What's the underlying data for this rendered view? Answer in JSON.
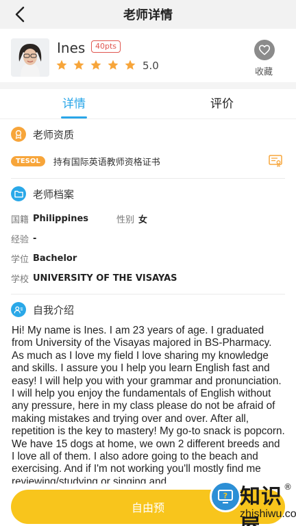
{
  "nav": {
    "title": "老师详情"
  },
  "teacher": {
    "name": "Ines",
    "points": "40pts",
    "rating": 5,
    "score": "5.0",
    "favorite_label": "收藏"
  },
  "tabs": [
    {
      "label": "详情",
      "active": true
    },
    {
      "label": "评价",
      "active": false
    }
  ],
  "qualification": {
    "title": "老师资质",
    "badge": "TESOL",
    "text": "持有国际英语教师资格证书"
  },
  "profile": {
    "title": "老师档案",
    "nationality_label": "国籍",
    "nationality": "Philippines",
    "gender_label": "性别",
    "gender": "女",
    "experience_label": "经验",
    "experience": "-",
    "degree_label": "学位",
    "degree": "Bachelor",
    "school_label": "学校",
    "school": "UNIVERSITY OF THE VISAYAS"
  },
  "intro": {
    "title": "自我介绍",
    "text": "Hi! My name is Ines. I am 23 years of age. I graduated from University of the Visayas majored in BS-Pharmacy. As much as I love my field I love sharing my knowledge and skills. I assure you I help you learn English fast and easy! I will help you with your grammar and pronunciation. I will help you enjoy the fundamentals of English without any pressure, here in my class please do not be afraid of making mistakes and trying over and over. After all, repetition is the key to mastery! My go-to snack is popcorn. We have 15 dogs at home, we own 2 different breeds and I love all of them. I also adore going to the beach and exercising. And if I'm not working you'll mostly find me reviewing/studying or singing and"
  },
  "bottom": {
    "label": "自由预"
  },
  "watermark": {
    "text": "知识屋",
    "sub": "zhishiwu.com",
    "reg": "®"
  },
  "colors": {
    "accent": "#29a6e8",
    "orange": "#f7a53a",
    "button": "#f8c51c",
    "star": "#f7a53a"
  }
}
